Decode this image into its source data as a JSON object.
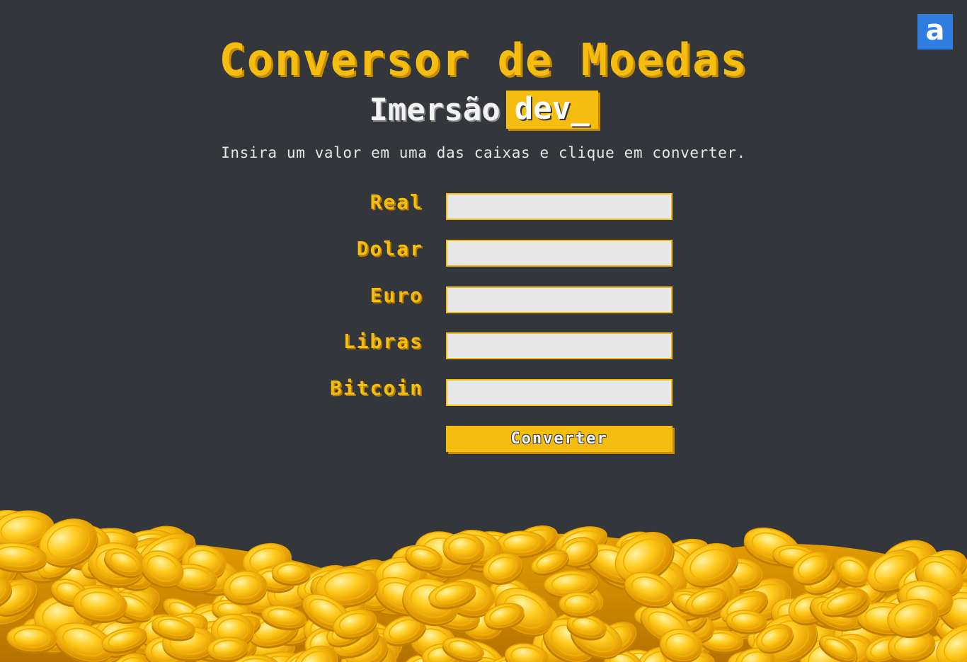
{
  "header": {
    "title": "Conversor de Moedas",
    "subtitle_prefix": "Imersão",
    "subtitle_badge": "dev_",
    "instructions": "Insira um valor em uma das caixas e clique em converter."
  },
  "form": {
    "fields": [
      {
        "label": "Real",
        "value": ""
      },
      {
        "label": "Dolar",
        "value": ""
      },
      {
        "label": "Euro",
        "value": ""
      },
      {
        "label": "Libras",
        "value": ""
      },
      {
        "label": "Bitcoin",
        "value": ""
      }
    ],
    "convert_label": "Converter"
  },
  "badge": {
    "letter": "a",
    "icon": "alura-logo-icon"
  },
  "decoration": {
    "icon": "gold-coins-pile"
  },
  "colors": {
    "background": "#33363b",
    "accent": "#f5bd0f",
    "accent_shadow": "#c98a00",
    "input_bg": "#e8e8e8",
    "badge_bg": "#2f7de1"
  }
}
